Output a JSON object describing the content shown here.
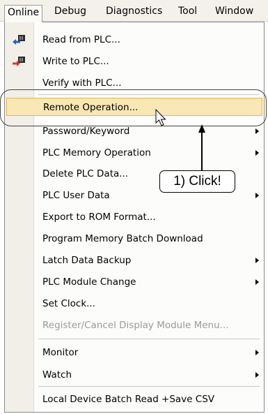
{
  "menubar": {
    "items": [
      {
        "label": "Online"
      },
      {
        "label": "Debug"
      },
      {
        "label": "Diagnostics"
      },
      {
        "label": "Tool"
      },
      {
        "label": "Window"
      }
    ]
  },
  "menu": {
    "items": [
      {
        "label": "Read from PLC...",
        "icon": "read-from-plc-icon"
      },
      {
        "label": "Write to PLC...",
        "icon": "write-to-plc-icon"
      },
      {
        "label": "Verify with PLC..."
      },
      {
        "label": "Remote Operation...",
        "state": "highlighted"
      },
      {
        "label": "Password/Keyword",
        "submenu": true
      },
      {
        "label": "PLC Memory Operation",
        "submenu": true
      },
      {
        "label": "Delete PLC Data..."
      },
      {
        "label": "PLC User Data",
        "submenu": true
      },
      {
        "label": "Export to ROM Format..."
      },
      {
        "label": "Program Memory Batch Download"
      },
      {
        "label": "Latch Data Backup",
        "submenu": true
      },
      {
        "label": "PLC Module Change",
        "submenu": true
      },
      {
        "label": "Set Clock..."
      },
      {
        "label": "Register/Cancel Display Module Menu...",
        "state": "disabled"
      },
      {
        "label": "Monitor",
        "submenu": true
      },
      {
        "label": "Watch",
        "submenu": true
      },
      {
        "label": "Local Device Batch Read +Save CSV"
      }
    ]
  },
  "annotation": {
    "callout_text": "1) Click!"
  },
  "colors": {
    "highlight_bg": "#fae7b6",
    "highlight_border": "#e3b84c",
    "gutter": "#f1efe7"
  }
}
